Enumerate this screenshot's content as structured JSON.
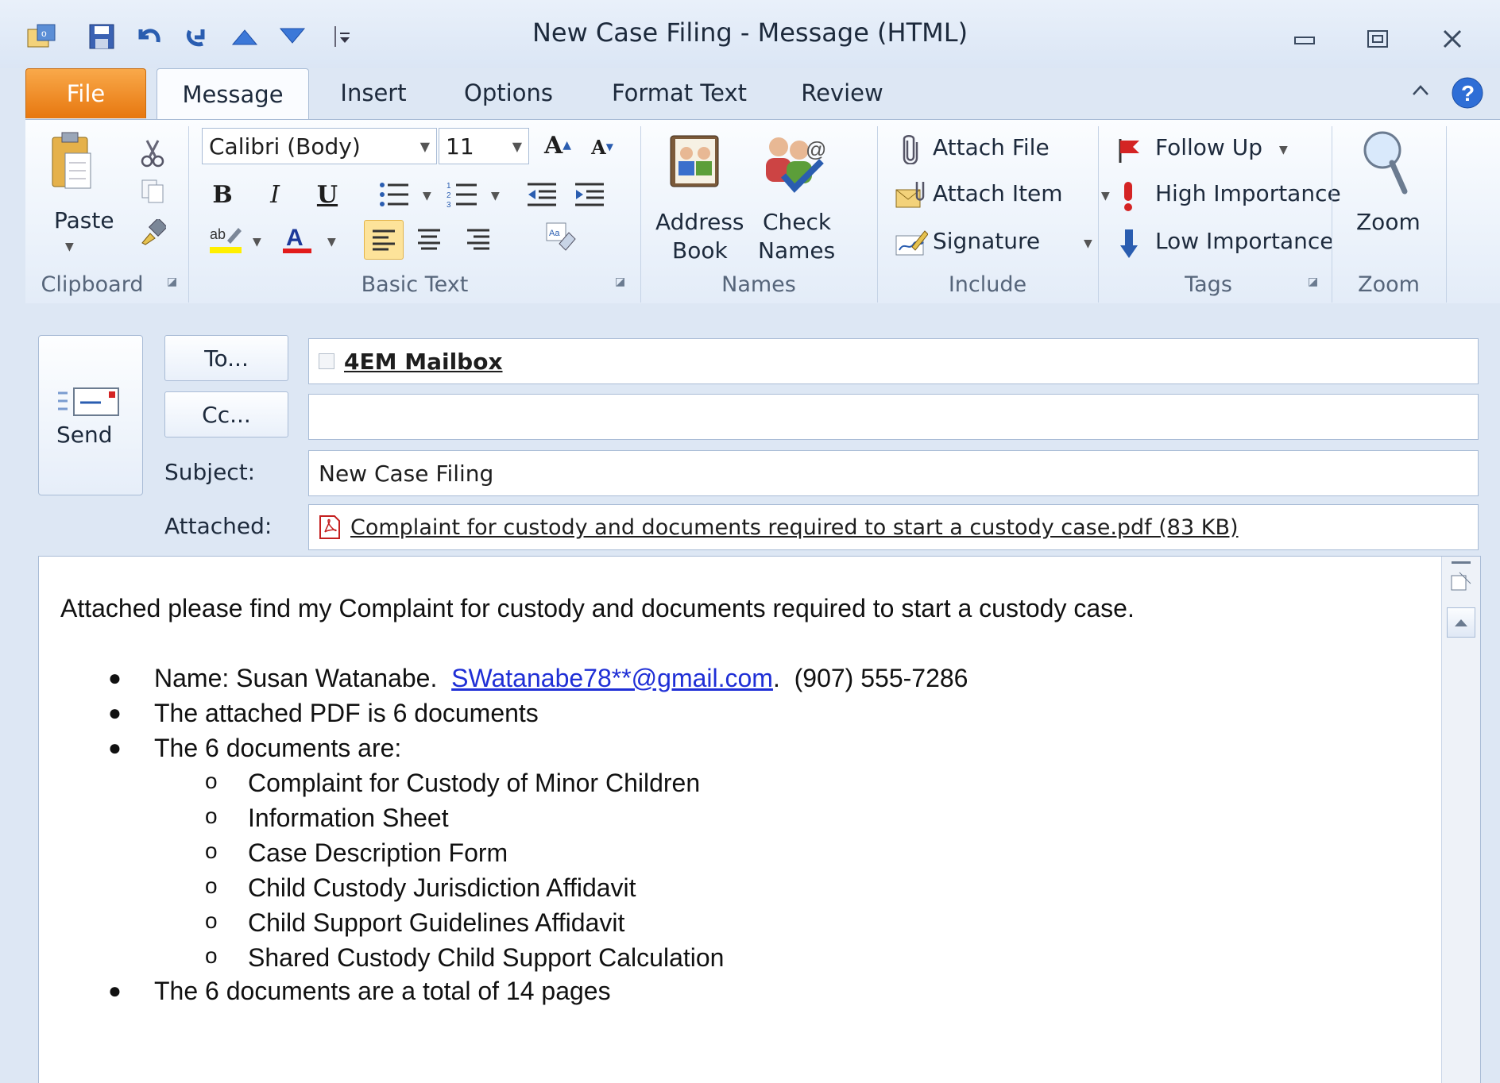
{
  "window": {
    "title": "New Case Filing  -  Message (HTML)"
  },
  "tabs": [
    "File",
    "Message",
    "Insert",
    "Options",
    "Format Text",
    "Review"
  ],
  "ribbon": {
    "clipboard": {
      "paste_label": "Paste",
      "group_label": "Clipboard"
    },
    "basic_text": {
      "font_name": "Calibri (Body)",
      "font_size": "11",
      "group_label": "Basic Text"
    },
    "names": {
      "address_book_line1": "Address",
      "address_book_line2": "Book",
      "check_names_line1": "Check",
      "check_names_line2": "Names",
      "group_label": "Names"
    },
    "include": {
      "attach_file": "Attach File",
      "attach_item": "Attach Item",
      "signature": "Signature",
      "group_label": "Include"
    },
    "tags": {
      "follow_up": "Follow Up",
      "high_importance": "High Importance",
      "low_importance": "Low Importance",
      "group_label": "Tags"
    },
    "zoom": {
      "zoom_label": "Zoom",
      "group_label": "Zoom"
    }
  },
  "header": {
    "send_label": "Send",
    "to_button": "To...",
    "cc_button": "Cc...",
    "to_value": "4EM Mailbox",
    "cc_value": "",
    "subject_label": "Subject:",
    "subject_value": "New Case Filing",
    "attached_label": "Attached:",
    "attachment": "Complaint for custody and documents required to start a custody case.pdf (83 KB)"
  },
  "body": {
    "intro": "Attached please find my Complaint for custody and documents required to start a custody case.",
    "name_prefix": "Name: Susan Watanabe.",
    "email": "SWatanabe78**@gmail.com",
    "email_suffix": ".",
    "phone": "(907) 555-7286",
    "bullet2": "The attached PDF is 6 documents",
    "bullet3": "The 6 documents are:",
    "documents": [
      "Complaint for Custody of Minor Children",
      "Information Sheet",
      "Case Description Form",
      "Child Custody Jurisdiction Affidavit",
      "Child Support Guidelines Affidavit",
      "Shared Custody Child Support Calculation"
    ],
    "bullet4": "The 6 documents are a total of 14 pages"
  },
  "colors": {
    "file_tab": "#e7770f",
    "link": "#1f2fd6",
    "accent": "#2a5db0"
  }
}
